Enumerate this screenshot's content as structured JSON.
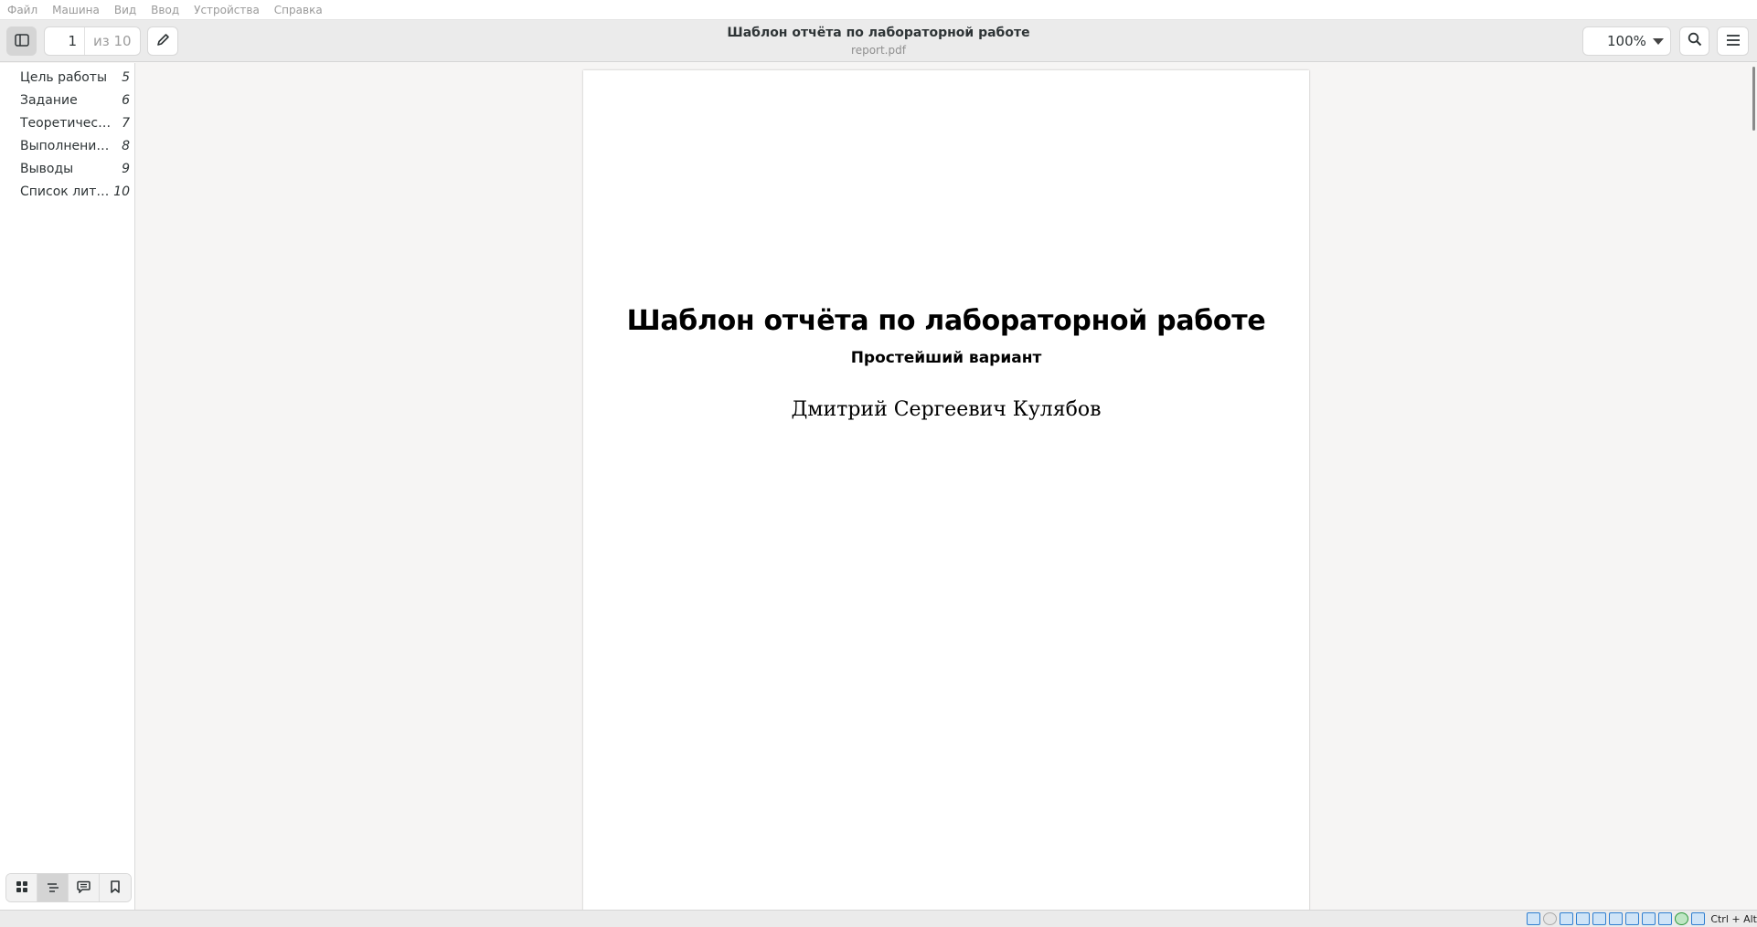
{
  "vm_menu": [
    "Файл",
    "Машина",
    "Вид",
    "Ввод",
    "Устройства",
    "Справка"
  ],
  "header": {
    "title": "Шаблон отчёта по лабораторной работе",
    "subtitle": "report.pdf",
    "current_page": "1",
    "total_pages": "из 10",
    "zoom": "100%"
  },
  "outline": [
    {
      "label": "Цель работы",
      "page": "5"
    },
    {
      "label": "Задание",
      "page": "6"
    },
    {
      "label": "Теоретичес…",
      "page": "7"
    },
    {
      "label": "Выполнение…",
      "page": "8"
    },
    {
      "label": "Выводы",
      "page": "9"
    },
    {
      "label": "Список лите…",
      "page": "10"
    }
  ],
  "document": {
    "title": "Шаблон отчёта по лабораторной работе",
    "subtitle": "Простейший вариант",
    "author": "Дмитрий Сергеевич Кулябов"
  },
  "statusbar": {
    "host_key": "Ctrl + Alt"
  },
  "icons": {
    "sidebar_toggle": "sidebar-icon",
    "annotate": "pencil-icon",
    "search": "search-icon",
    "menu": "hamburger-menu-icon",
    "view_thumbnails": "grid-icon",
    "view_outline": "outline-icon",
    "view_annotations": "comment-icon",
    "view_bookmarks": "bookmark-icon"
  }
}
